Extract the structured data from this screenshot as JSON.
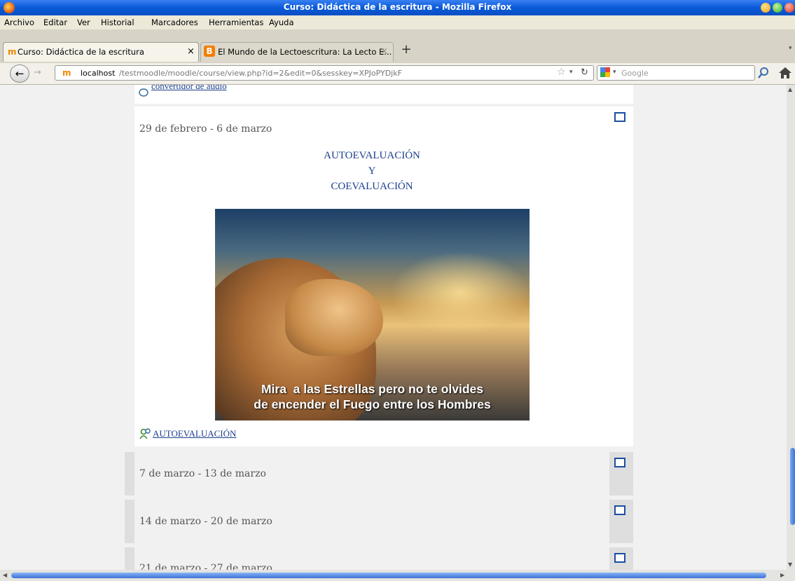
{
  "window": {
    "title": "Curso: Didáctica de la escritura - Mozilla Firefox"
  },
  "menu": [
    "Archivo",
    "Editar",
    "Ver",
    "Historial",
    "Marcadores",
    "Herramientas",
    "Ayuda"
  ],
  "tabs": [
    {
      "label": "Curso: Didáctica de la escritura",
      "close": "×"
    },
    {
      "label": "El Mundo de la Lectoescritura: La Lecto E...",
      "close": "×"
    }
  ],
  "new_tab": "+",
  "nav": {
    "url_host": "localhost",
    "url_path": "/testmoodle/moodle/course/view.php?id=2&edit=0&sesskey=XPJoPYDjkF",
    "search_placeholder": "Google"
  },
  "content": {
    "top_link": "convertidor de audio",
    "sections": [
      {
        "date": "29 de febrero - 6 de marzo"
      },
      {
        "date": "7 de marzo - 13 de marzo"
      },
      {
        "date": "14 de marzo - 20 de marzo"
      },
      {
        "date": "21 de marzo - 27 de marzo"
      }
    ],
    "heading_lines": [
      "AUTOEVALUACIÓN",
      "Y",
      "COEVALUACIÓN"
    ],
    "image_caption_lines": [
      "Mira  a las Estrellas pero no te olvides",
      "de encender el Fuego entre los Hombres"
    ],
    "activity_link": "AUTOEVALUACIÓN"
  },
  "colors": {
    "link": "#1a3e8c",
    "titlebar": "#0a5ad8",
    "edit_icon": "#1a4fa0"
  }
}
